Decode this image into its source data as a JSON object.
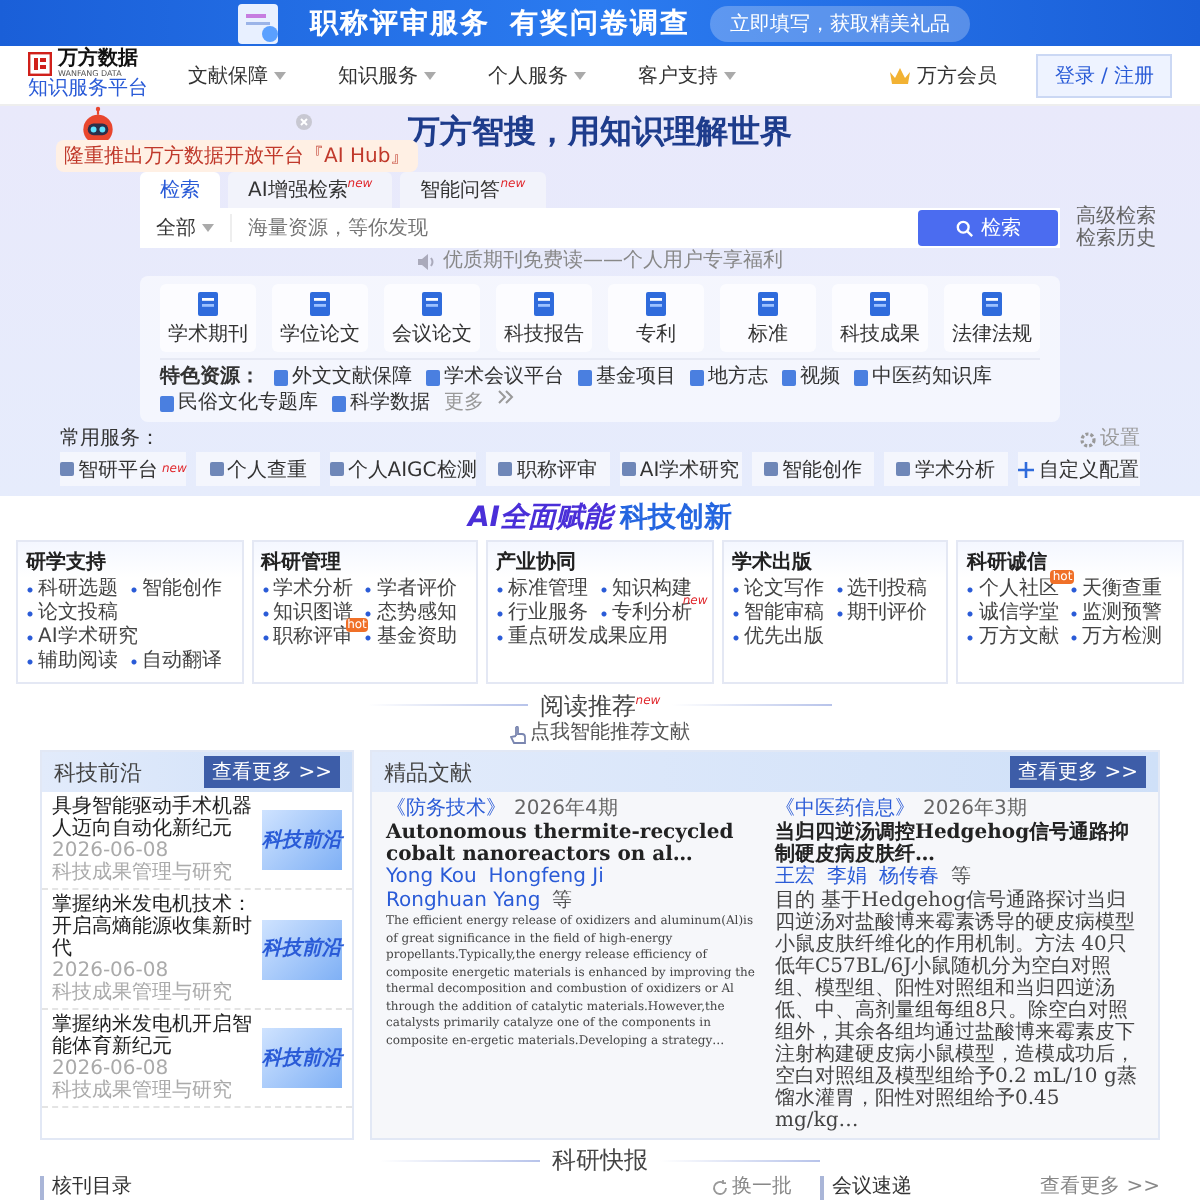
{
  "banner": {
    "title": "职称评审服务",
    "title_2": "有奖问卷调查",
    "cta": "立即填写，获取精美礼品"
  },
  "header": {
    "logo": {
      "name": "万方数据",
      "sub": "WANFANG DATA",
      "tagline": "知识服务平台"
    },
    "nav": [
      {
        "label": "文献保障"
      },
      {
        "label": "知识服务"
      },
      {
        "label": "个人服务"
      },
      {
        "label": "客户支持"
      }
    ],
    "vip": "万方会员",
    "login": "登录 / 注册"
  },
  "promo": {
    "text": "隆重推出万方数据开放平台『AI Hub』"
  },
  "hero": {
    "title": "万方智搜，用知识理解世界",
    "tabs": [
      {
        "label": "检索",
        "selected": true
      },
      {
        "label": "AI增强检索",
        "selected": false,
        "badge": "new"
      },
      {
        "label": "智能问答",
        "selected": false,
        "badge": "new"
      }
    ],
    "search": {
      "scope": "全部",
      "placeholder": "海量资源，等你发现",
      "button": "检索"
    },
    "links": [
      "高级检索",
      "检索历史"
    ],
    "notice": "优质期刊免费读——个人用户专享福利"
  },
  "resources": [
    "学术期刊",
    "学位论文",
    "会议论文",
    "科技报告",
    "专利",
    "标准",
    "科技成果",
    "法律法规"
  ],
  "featured": {
    "label": "特色资源：",
    "items": [
      "外文文献保障",
      "学术会议平台",
      "基金项目",
      "地方志",
      "视频",
      "中医药知识库",
      "民俗文化专题库",
      "科学数据"
    ],
    "more": "更多"
  },
  "services": {
    "label": "常用服务：",
    "settings": "设置",
    "items": [
      {
        "kind": "link",
        "label": "智研平台",
        "badge": "new"
      },
      {
        "kind": "link",
        "label": "个人查重"
      },
      {
        "kind": "link",
        "label": "个人AIGC检测"
      },
      {
        "kind": "link",
        "label": "职称评审"
      },
      {
        "kind": "link",
        "label": "AI学术研究"
      },
      {
        "kind": "link",
        "label": "智能创作"
      },
      {
        "kind": "link",
        "label": "学术分析"
      },
      {
        "kind": "add",
        "label": "自定义配置"
      }
    ]
  },
  "ai_section": {
    "title": "AI全面赋能",
    "title_2": "科技创新",
    "cards": [
      {
        "title": "研学支持",
        "items": [
          {
            "label": "科研选题"
          },
          {
            "label": "智能创作"
          },
          {
            "label": "论文投稿"
          },
          {
            "label": "AI学术研究"
          },
          {
            "label": "辅助阅读"
          },
          {
            "label": "自动翻译"
          }
        ]
      },
      {
        "title": "科研管理",
        "items": [
          {
            "label": "学术分析"
          },
          {
            "label": "学者评价"
          },
          {
            "label": "知识图谱"
          },
          {
            "label": "态势感知"
          },
          {
            "label": "职称评审",
            "badge": "hot"
          },
          {
            "label": "基金资助"
          }
        ]
      },
      {
        "title": "产业协同",
        "items": [
          {
            "label": "标准管理"
          },
          {
            "label": "知识构建"
          },
          {
            "label": "行业服务"
          },
          {
            "label": "专利分析",
            "badge": "new"
          },
          {
            "label": "重点研发成果应用"
          }
        ]
      },
      {
        "title": "学术出版",
        "items": [
          {
            "label": "论文写作"
          },
          {
            "label": "选刊投稿"
          },
          {
            "label": "智能审稿"
          },
          {
            "label": "期刊评价"
          },
          {
            "label": "优先出版"
          }
        ]
      },
      {
        "title": "科研诚信",
        "items": [
          {
            "label": "个人社区",
            "badge": "hot"
          },
          {
            "label": "天衡查重"
          },
          {
            "label": "诚信学堂"
          },
          {
            "label": "监测预警"
          },
          {
            "label": "万方文献"
          },
          {
            "label": "万方检测"
          }
        ]
      }
    ]
  },
  "reading": {
    "title": "阅读推荐",
    "badge": "new",
    "subtitle": "点我智能推荐文献"
  },
  "frontier": {
    "title": "科技前沿",
    "more": "查看更多 >>",
    "items": [
      {
        "title": "具身智能驱动手术机器人迈向自动化新纪元",
        "date": "2026-06-08",
        "source": "科技成果管理与研究",
        "thumb": "科技前沿"
      },
      {
        "title": "掌握纳米发电机技术：开启高熵能源收集新时代",
        "date": "2026-06-08",
        "source": "科技成果管理与研究",
        "thumb": "科技前沿"
      },
      {
        "title": "掌握纳米发电机开启智能体育新纪元",
        "date": "2026-06-08",
        "source": "科技成果管理与研究",
        "thumb": "科技前沿"
      }
    ]
  },
  "featured_docs": {
    "title": "精品文献",
    "more": "查看更多 >>",
    "articles": [
      {
        "journal": "《防务技术》",
        "issue": "2026年4期",
        "title": "Autonomous thermite-recycled cobalt nanoreactors on al…",
        "authors": [
          "Yong Kou",
          "Hongfeng Ji",
          "Ronghuan Yang"
        ],
        "etal": "等",
        "abstract": "The efficient energy release of oxidizers and aluminum(Al)is of great significance in the field of high-energy propellants.Typically,the energy release efficiency of composite energetic materials is enhanced by improving the thermal decomposition and combustion of oxidizers or Al through the addition of catalytic materials.However,the catalysts primarily catalyze one of the components in composite en-ergetic materials.Developing a strategy…"
      },
      {
        "journal": "《中医药信息》",
        "issue": "2026年3期",
        "title": "当归四逆汤调控Hedgehog信号通路抑制硬皮病皮肤纤…",
        "authors": [
          "王宏",
          "李娟",
          "杨传春"
        ],
        "etal": "等",
        "abstract": "目的 基于Hedgehog信号通路探讨当归四逆汤对盐酸博来霉素诱导的硬皮病模型小鼠皮肤纤维化的作用机制。方法 40只低年C57BL/6J小鼠随机分为空白对照组、模型组、阳性对照组和当归四逆汤低、中、高剂量组每组8只。除空白对照组外，其余各组均通过盐酸博来霉素皮下注射构建硬皮病小鼠模型，造模成功后，空白对照组及模型组给予0.2 mL/10 g蒸馏水灌胃，阳性对照组给予0.45 mg/kg…"
      }
    ]
  },
  "news": {
    "title": "科研快报",
    "left": {
      "title": "核刊目录",
      "action": "换一批"
    },
    "right": {
      "title": "会议速递",
      "more": "查看更多 >>"
    }
  }
}
